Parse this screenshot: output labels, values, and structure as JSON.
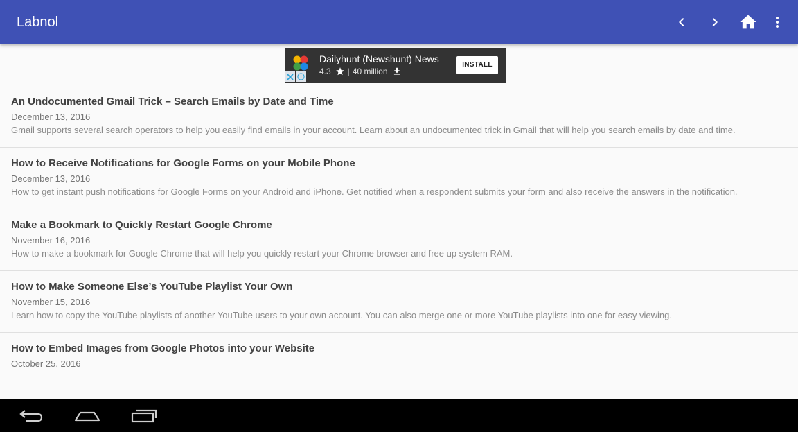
{
  "app_bar": {
    "title": "Labnol",
    "actions": [
      {
        "icon": "chevron-left-icon"
      },
      {
        "icon": "chevron-right-icon"
      },
      {
        "icon": "home-icon"
      },
      {
        "icon": "more-vert-icon"
      }
    ],
    "color": "#3f51b5"
  },
  "ad": {
    "app_name": "Dailyhunt (Newshunt) News",
    "rating": "4.3",
    "installs": "40 million",
    "install_label": "INSTALL"
  },
  "articles": [
    {
      "title": "An Undocumented Gmail Trick – Search Emails by Date and Time",
      "date": "December 13, 2016",
      "summary": "Gmail supports several search operators to help you easily find emails in your account. Learn about an undocumented trick in Gmail that will help you search emails by date and time."
    },
    {
      "title": "How to Receive Notifications for Google Forms on your Mobile Phone",
      "date": "December 13, 2016",
      "summary": "How to get instant push notifications for Google Forms on your Android and iPhone. Get notified when a respondent submits your form and also receive the answers in the notification."
    },
    {
      "title": "Make a Bookmark to Quickly Restart Google Chrome",
      "date": "November 16, 2016",
      "summary": "How to make a bookmark for Google Chrome that will help you quickly restart your Chrome browser and free up system RAM."
    },
    {
      "title": "How to Make Someone Else’s YouTube Playlist Your Own",
      "date": "November 15, 2016",
      "summary": "Learn how to copy the YouTube playlists of another YouTube users to your own account. You can also merge one or more YouTube playlists into one for easy viewing."
    },
    {
      "title": "How to Embed Images from Google Photos into your Website",
      "date": "October 25, 2016",
      "summary": ""
    }
  ],
  "nav_bar": {
    "buttons": [
      {
        "icon": "back-icon"
      },
      {
        "icon": "home-icon"
      },
      {
        "icon": "recent-apps-icon"
      }
    ]
  }
}
